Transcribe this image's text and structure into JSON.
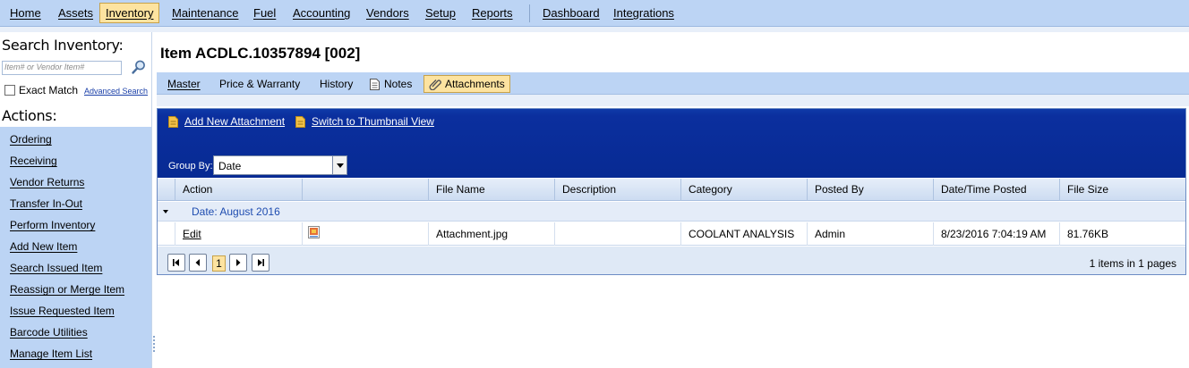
{
  "menu": {
    "items": [
      "Home",
      "Assets",
      "Inventory",
      "Maintenance",
      "Fuel",
      "Accounting",
      "Vendors",
      "Setup",
      "Reports"
    ],
    "extra_items": [
      "Dashboard",
      "Integrations"
    ],
    "active": "Inventory"
  },
  "sidebar": {
    "search_title": "Search Inventory:",
    "search_placeholder": "Item# or Vendor Item#",
    "exact_match": "Exact Match",
    "advanced_search": "Advanced Search",
    "actions_title": "Actions:",
    "actions": [
      "Ordering",
      "Receiving",
      "Vendor Returns",
      "Transfer In-Out",
      "Perform Inventory",
      "Add New Item",
      "Search Issued Item",
      "Reassign or Merge Item",
      "Issue Requested Item",
      "Barcode Utilities",
      "Manage Item List"
    ]
  },
  "page": {
    "title": "Item ACDLC.10357894 [002]"
  },
  "tabs": [
    "Master",
    "Price & Warranty",
    "History",
    "Notes",
    "Attachments"
  ],
  "active_tab": "Attachments",
  "panel": {
    "add_attachment": "Add New Attachment",
    "thumbnail_view": "Switch to Thumbnail View",
    "group_by_label": "Group By:",
    "group_by_value": "Date"
  },
  "grid": {
    "columns": [
      "Action",
      "",
      "File Name",
      "Description",
      "Category",
      "Posted By",
      "Date/Time Posted",
      "File Size"
    ],
    "group_label": "Date: August 2016",
    "rows": [
      {
        "action": "Edit",
        "file_name": "Attachment.jpg",
        "description": "",
        "category": "COOLANT ANALYSIS",
        "posted_by": "Admin",
        "posted": "8/23/2016 7:04:19 AM",
        "size": "81.76KB"
      }
    ]
  },
  "pager": {
    "page": "1",
    "info": "1 items in 1 pages"
  },
  "colors": {
    "menu_bg": "#bcd4f4",
    "active_bg": "#fde3a0",
    "panel_header": "#0b2f9e",
    "group_text": "#1f4db0"
  }
}
